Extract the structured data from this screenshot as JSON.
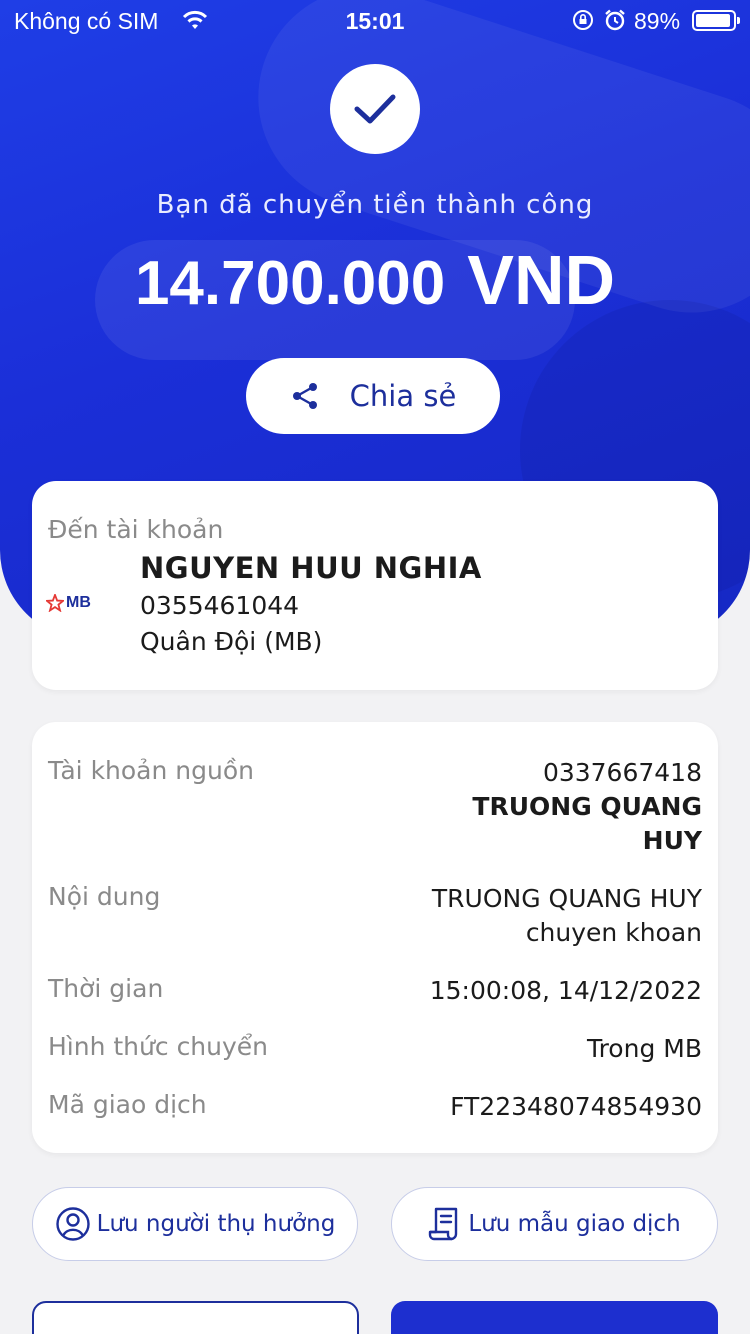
{
  "status_bar": {
    "carrier": "Không có SIM",
    "time": "15:01",
    "battery": "89%"
  },
  "hero": {
    "message": "Bạn đã chuyển tiền thành công",
    "amount": "14.700.000",
    "currency": "VND",
    "share_label": "Chia sẻ"
  },
  "recipient": {
    "label": "Đến tài khoản",
    "name": "NGUYEN HUU NGHIA",
    "account": "0355461044",
    "bank": "Quân Đội (MB)",
    "bank_logo_text": "MB"
  },
  "details": {
    "source_label": "Tài khoản nguồn",
    "source_account": "0337667418",
    "source_name_line1": "TRUONG QUANG",
    "source_name_line2": "HUY",
    "content_label": "Nội dung",
    "content_line1": "TRUONG QUANG HUY",
    "content_line2": "chuyen khoan",
    "time_label": "Thời gian",
    "time_value": "15:00:08, 14/12/2022",
    "method_label": "Hình thức chuyển",
    "method_value": "Trong MB",
    "txid_label": "Mã giao dịch",
    "txid_value": "FT22348074854930"
  },
  "actions": {
    "save_recipient": "Lưu người thụ hưởng",
    "save_template": "Lưu mẫu giao dịch"
  },
  "colors": {
    "brand_blue": "#1d2fcf",
    "text_dark_blue": "#1d2f9c",
    "logo_red": "#e53935"
  }
}
